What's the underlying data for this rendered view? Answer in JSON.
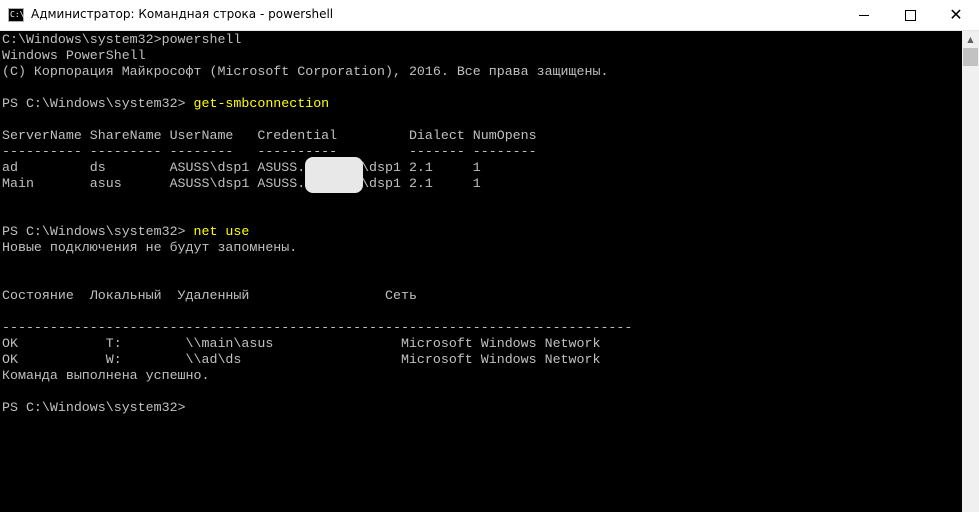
{
  "window": {
    "title": "Администратор: Командная строка - powershell",
    "icon_label": "C:\\",
    "icon": "console-icon"
  },
  "controls": {
    "minimize": "minimize-icon",
    "maximize": "maximize-icon",
    "close_label": "✕"
  },
  "console": {
    "l1": "C:\\Windows\\system32>powershell",
    "l2": "Windows PowerShell",
    "l3": "(C) Корпорация Майкрософт (Microsoft Corporation), 2016. Все права защищены.",
    "l4_prompt": "PS C:\\Windows\\system32> ",
    "l4_cmd": "get-smbconnection",
    "l5": "ServerName ShareName UserName   Credential         Dialect NumOpens",
    "l6": "---------- --------- --------   ----------         ------- --------",
    "l7": "ad         ds        ASUSS\\dsp1 ASUSS.       \\dsp1 2.1     1",
    "l8": "Main       asus      ASUSS\\dsp1 ASUSS.       \\dsp1 2.1     1",
    "l9_prompt": "PS C:\\Windows\\system32> ",
    "l9_cmd": "net use",
    "l10": "Новые подключения не будут запомнены.",
    "l11": "Состояние  Локальный  Удаленный                 Сеть",
    "l12": "-------------------------------------------------------------------------------",
    "l13": "OK           T:        \\\\main\\asus                Microsoft Windows Network",
    "l14": "OK           W:        \\\\ad\\ds                    Microsoft Windows Network",
    "l15": "Команда выполнена успешно.",
    "l16_prompt": "PS C:\\Windows\\system32>"
  },
  "colors": {
    "background": "#000000",
    "text": "#c0c0c0",
    "command": "#ffff00"
  }
}
